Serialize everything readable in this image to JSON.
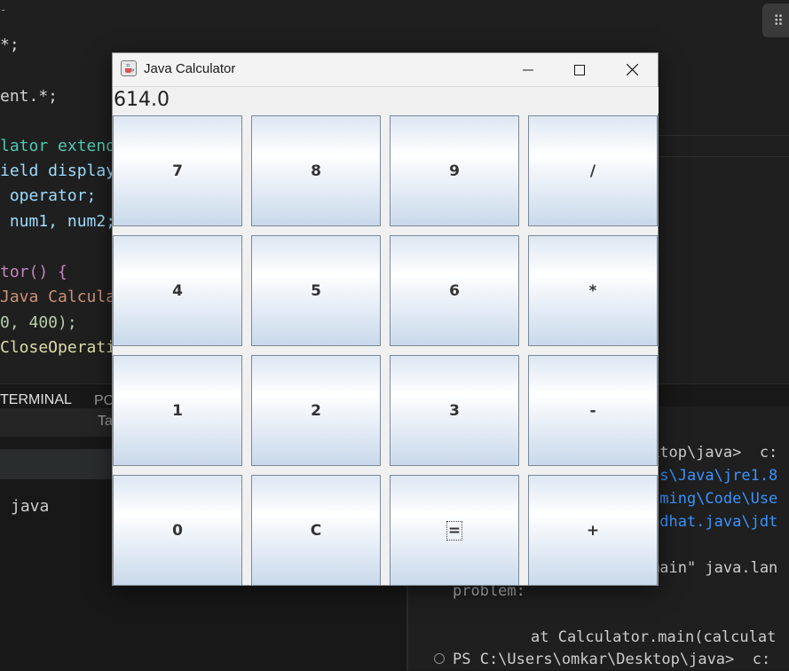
{
  "editor": {
    "lines": [
      "*;",
      "ent.*;",
      "lator extends",
      "ield display",
      " operator;",
      " num1, num2;",
      "tor() {",
      "Java Calcula",
      "0, 400);",
      "CloseOperati"
    ],
    "top_tag": "-",
    "layout_icon": "grid-dots-icon"
  },
  "panel": {
    "tabs": [
      "TERMINAL",
      "PO"
    ],
    "tasks_label": "Ta",
    "left_item": "java",
    "terminal_lines": [
      "ktop\\java>  c:",
      "es\\Java\\jre1.8",
      "aming\\Code\\Use",
      "edhat.java\\jdt",
      "main\" java.lan",
      "problem:",
      "at Calculator.main(calculat",
      "PS C:\\Users\\omkar\\Desktop\\java>  c:"
    ]
  },
  "calculator": {
    "title": "Java Calculator",
    "display_value": "614.0",
    "keys": [
      [
        "7",
        "8",
        "9",
        "/"
      ],
      [
        "4",
        "5",
        "6",
        "*"
      ],
      [
        "1",
        "2",
        "3",
        "-"
      ],
      [
        "0",
        "C",
        "=",
        "+"
      ]
    ],
    "colors": {
      "key_top": "#dce6f2",
      "key_bottom": "#c9d9eb",
      "key_border": "#7a8a9b",
      "window_bg": "#f0f0f0"
    }
  }
}
